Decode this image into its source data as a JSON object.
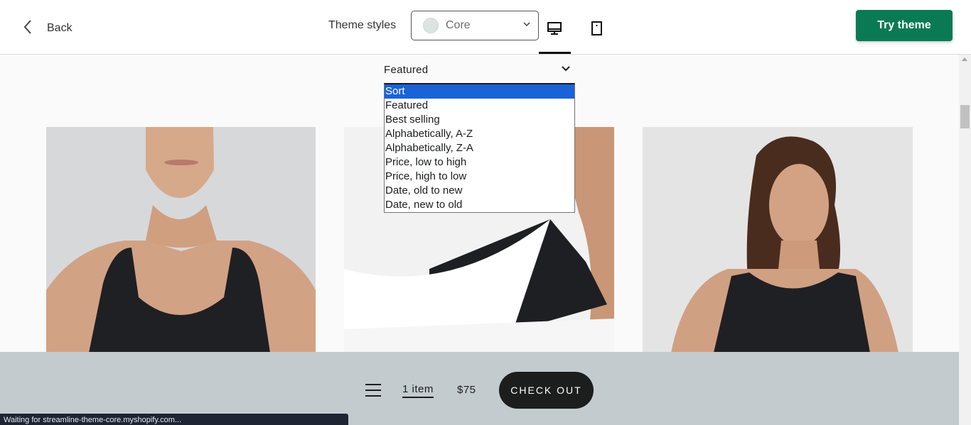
{
  "topbar": {
    "back_label": "Back",
    "theme_styles_label": "Theme styles",
    "theme_style_value": "Core",
    "try_theme_label": "Try theme",
    "accent_color": "#0a7a55",
    "device_icons": [
      "desktop-icon",
      "mobile-icon"
    ]
  },
  "sort": {
    "current": "Featured",
    "options": [
      "Sort",
      "Featured",
      "Best selling",
      "Alphabetically, A-Z",
      "Alphabetically, Z-A",
      "Price, low to high",
      "Price, high to low",
      "Date, old to new",
      "Date, new to old"
    ],
    "highlighted": "Sort"
  },
  "cart": {
    "items_label": "1 item",
    "total": "$75",
    "checkout_label": "CHECK OUT"
  },
  "status": {
    "text": "Waiting for streamline-theme-core.myshopify.com..."
  }
}
